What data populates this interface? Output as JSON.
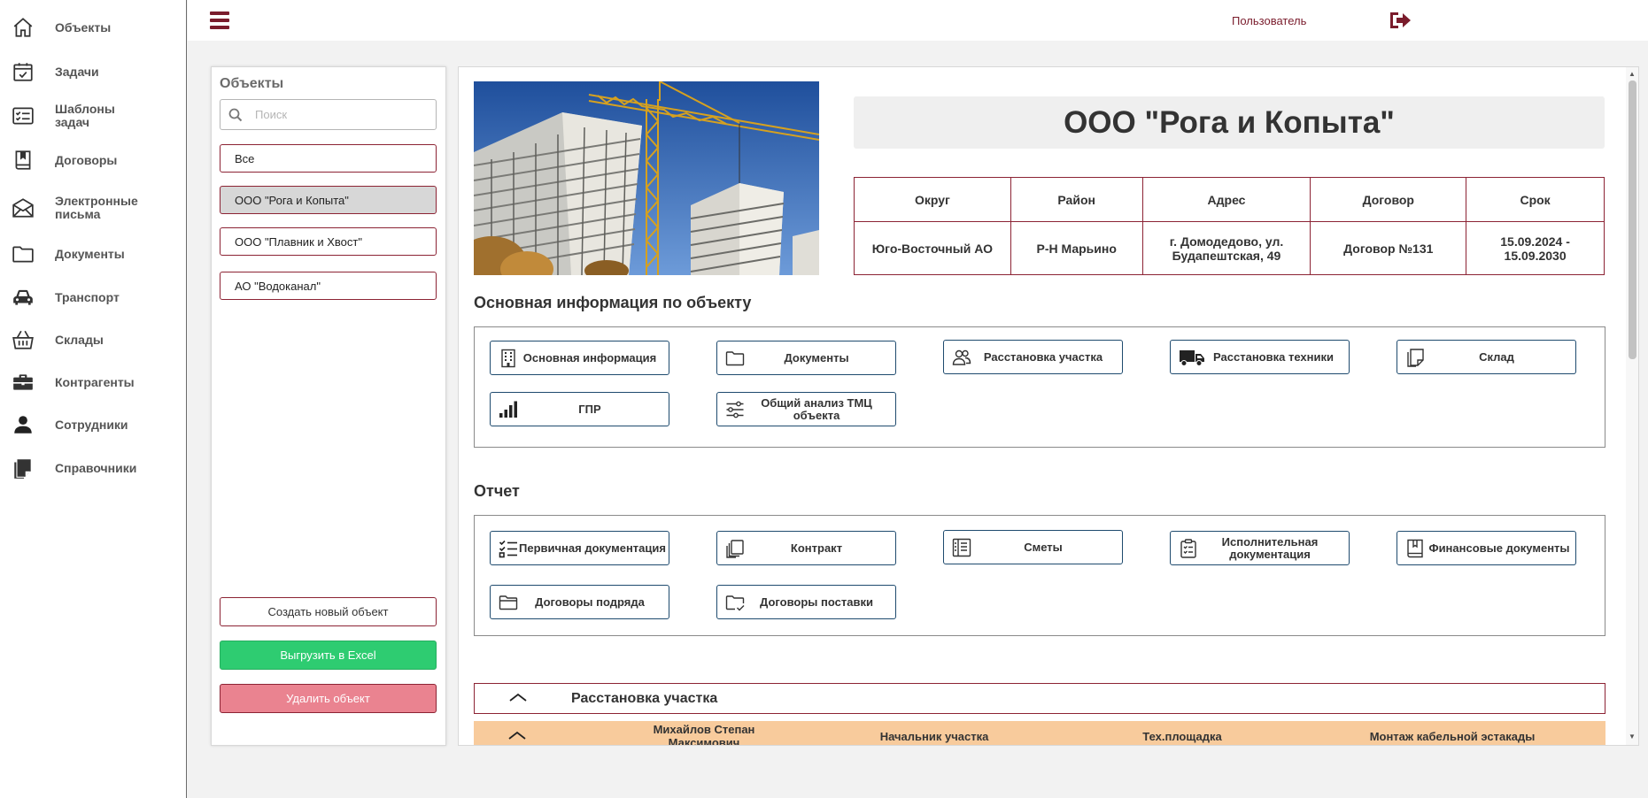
{
  "sidebar": {
    "items": [
      {
        "label": "Объекты",
        "icon": "home-icon"
      },
      {
        "label": "Задачи",
        "icon": "calendar-check-icon"
      },
      {
        "label": "Шаблоны задач",
        "icon": "checklist-icon"
      },
      {
        "label": "Договоры",
        "icon": "book-icon"
      },
      {
        "label": "Электронные письма",
        "icon": "envelope-icon"
      },
      {
        "label": "Документы",
        "icon": "folder-icon"
      },
      {
        "label": "Транспорт",
        "icon": "car-icon"
      },
      {
        "label": "Склады",
        "icon": "basket-icon"
      },
      {
        "label": "Контрагенты",
        "icon": "briefcase-icon"
      },
      {
        "label": "Сотрудники",
        "icon": "person-icon"
      },
      {
        "label": "Справочники",
        "icon": "notes-icon"
      }
    ]
  },
  "topbar": {
    "user_label": "Пользователь"
  },
  "objects_panel": {
    "title": "Объекты",
    "search_placeholder": "Поиск",
    "items": [
      "Все",
      "ООО \"Рога и Копыта\"",
      "ООО \"Плавник и Хвост\"",
      "АО \"Водоканал\""
    ],
    "active_index": 1,
    "create_label": "Создать новый объект",
    "excel_label": "Выгрузить в Excel",
    "delete_label": "Удалить объект"
  },
  "object": {
    "title": "ООО \"Рога и Копыта\"",
    "table": {
      "headers": [
        "Округ",
        "Район",
        "Адрес",
        "Договор",
        "Срок"
      ],
      "values": [
        "Юго-Восточный АО",
        "Р-Н Марьино",
        "г. Домодедово, ул. Будапештская, 49",
        "Договор №131",
        "15.09.2024 - 15.09.2030"
      ]
    }
  },
  "main_info": {
    "title": "Основная информация по объекту",
    "buttons": [
      {
        "label": "Основная информация",
        "icon": "building-icon"
      },
      {
        "label": "Документы",
        "icon": "folder-icon"
      },
      {
        "label": "Расстановка участка",
        "icon": "people-icon"
      },
      {
        "label": "Расстановка техники",
        "icon": "truck-icon"
      },
      {
        "label": "Склад",
        "icon": "sticky-note-icon"
      },
      {
        "label": "ГПР",
        "icon": "signal-bars-icon"
      },
      {
        "label": "Общий анализ ТМЦ объекта",
        "icon": "sliders-icon"
      }
    ]
  },
  "report": {
    "title": "Отчет",
    "buttons": [
      {
        "label": "Первичная документация",
        "icon": "checklist-icon"
      },
      {
        "label": "Контракт",
        "icon": "copy-icon"
      },
      {
        "label": "Сметы",
        "icon": "journal-icon"
      },
      {
        "label": "Исполнительная документация",
        "icon": "clipboard-icon"
      },
      {
        "label": "Финансовые документы",
        "icon": "bookmark-book-icon"
      },
      {
        "label": "Договоры подряда",
        "icon": "folder-open-icon"
      },
      {
        "label": "Договоры поставки",
        "icon": "folder-check-icon"
      }
    ]
  },
  "placement": {
    "title": "Расстановка участка",
    "row": {
      "name": "Михайлов Степан Максимович",
      "role": "Начальник участка",
      "site": "Тех.площадка",
      "work": "Монтаж кабельной эстакады"
    }
  },
  "colors": {
    "brand": "#7a1c2c",
    "border_red": "#8c2334",
    "button_border": "#1e4a6e",
    "excel": "#2ecc71",
    "delete": "#ea8390",
    "row_highlight": "#f8cb9c"
  }
}
